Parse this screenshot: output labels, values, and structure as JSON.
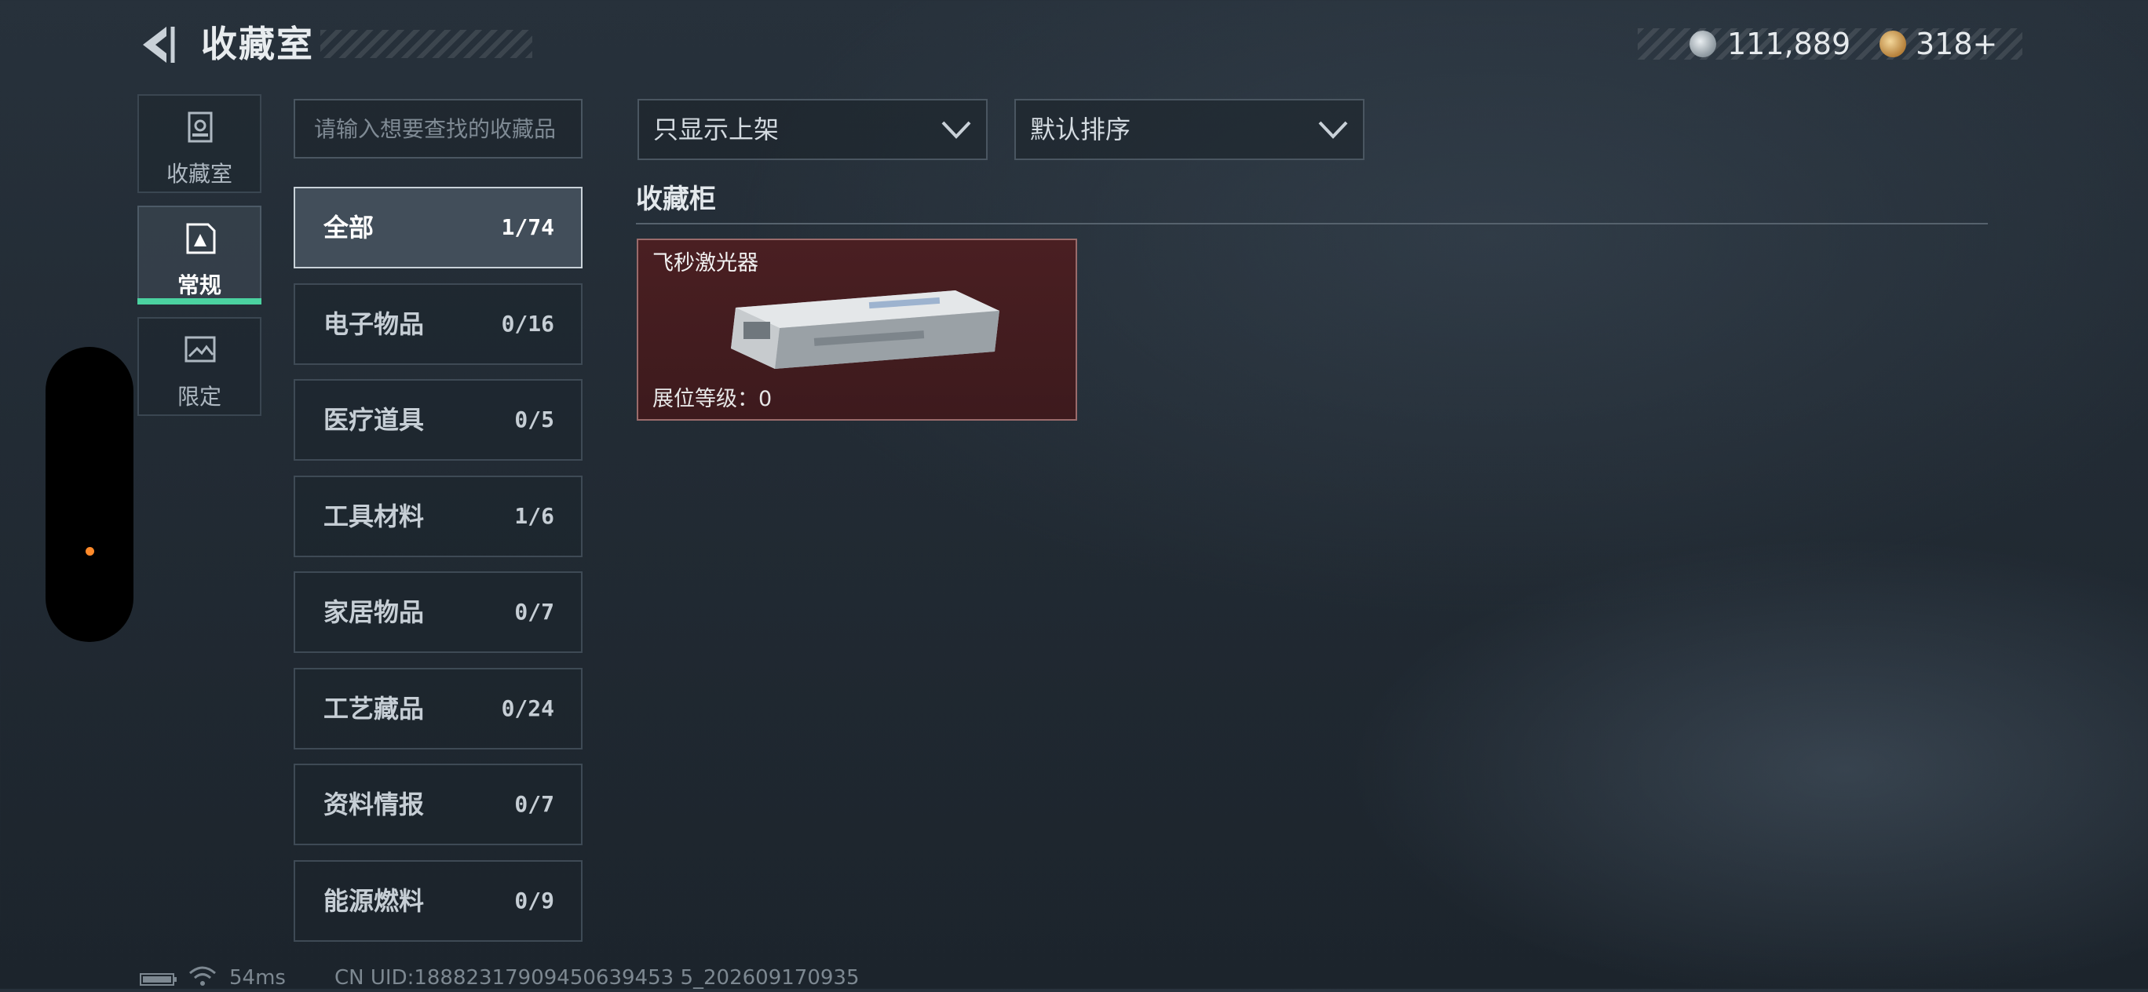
{
  "header": {
    "title": "收藏室",
    "currencies": {
      "silver": "111,889",
      "gold": "318+"
    }
  },
  "side_tabs": [
    {
      "label": "收藏室",
      "selected": false
    },
    {
      "label": "常规",
      "selected": true
    },
    {
      "label": "限定",
      "selected": false
    }
  ],
  "search": {
    "placeholder": "请输入想要查找的收藏品",
    "value": ""
  },
  "categories": [
    {
      "name": "全部",
      "count": "1/74",
      "selected": true
    },
    {
      "name": "电子物品",
      "count": "0/16"
    },
    {
      "name": "医疗道具",
      "count": "0/5"
    },
    {
      "name": "工具材料",
      "count": "1/6"
    },
    {
      "name": "家居物品",
      "count": "0/7"
    },
    {
      "name": "工艺藏品",
      "count": "0/24"
    },
    {
      "name": "资料情报",
      "count": "0/7"
    },
    {
      "name": "能源燃料",
      "count": "0/9"
    }
  ],
  "filters": {
    "display": "只显示上架",
    "sort": "默认排序"
  },
  "section": {
    "title": "收藏柜",
    "items": [
      {
        "name": "飞秒激光器",
        "level_label": "展位等级：0",
        "icon": "laser-device-icon",
        "rarity_color": "#4a1f22"
      }
    ]
  },
  "footer": {
    "ping": "54ms",
    "uid": "CN UID:18882317909450639453 5_202609170935"
  },
  "colors": {
    "accent": "#4bd2a0",
    "indicator": "#ff8a2a"
  }
}
